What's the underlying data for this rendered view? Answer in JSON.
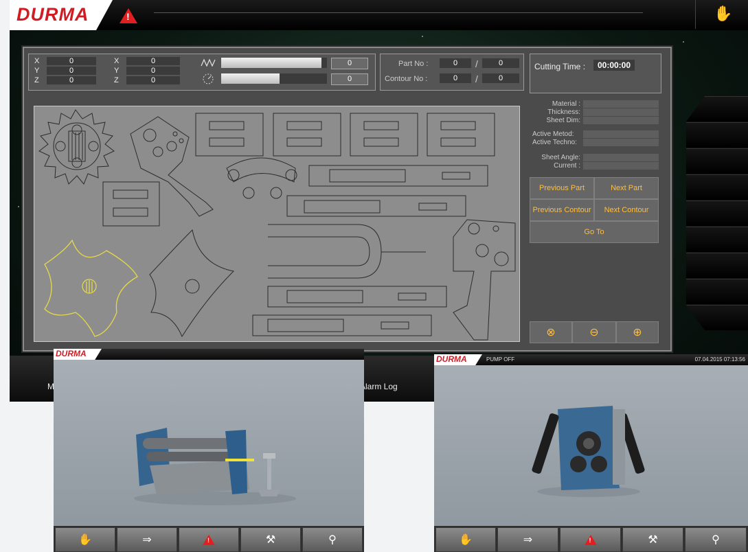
{
  "brand": {
    "name": "DURMA"
  },
  "coords": {
    "left": [
      {
        "axis": "X",
        "value": "0"
      },
      {
        "axis": "Y",
        "value": "0"
      },
      {
        "axis": "Z",
        "value": "0"
      }
    ],
    "right": [
      {
        "axis": "X",
        "value": "0"
      },
      {
        "axis": "Y",
        "value": "0"
      },
      {
        "axis": "Z",
        "value": "0"
      }
    ],
    "feed_value": "0",
    "speed_value": "0",
    "feed_fill": 0.95,
    "speed_fill": 0.55
  },
  "part": {
    "part_no_label": "Part No :",
    "part_no": "0",
    "part_total": "0",
    "contour_no_label": "Contour No :",
    "contour_no": "0",
    "contour_total": "0",
    "separator": "/"
  },
  "cutting": {
    "label": "Cutting Time :",
    "value": "00:00:00"
  },
  "info": {
    "material": "Material :",
    "thickness": "Thickness:",
    "sheet_dim": "Sheet Dim:",
    "active_metod": "Active Metod:",
    "active_techno": "Active Techno:",
    "sheet_angle": "Sheet Angle:",
    "current": "Current :"
  },
  "buttons": {
    "previous_part": "Previous Part",
    "next_part": "Next Part",
    "previous_contour": "Previous Contour",
    "next_contour": "Next Contour",
    "go_to": "Go To"
  },
  "bottom": {
    "alarm_log": "Alarm Log",
    "m_label": "M"
  },
  "screen2": {
    "status": "PUMP OFF",
    "datetime": "07.04.2015 07:13:56"
  },
  "colors": {
    "brand_red": "#d01c24",
    "button_text": "#ffbf3f",
    "highlight_part": "#e6d84a"
  },
  "icons": {
    "top_hand": "hand-icon",
    "warning": "warning-icon"
  }
}
